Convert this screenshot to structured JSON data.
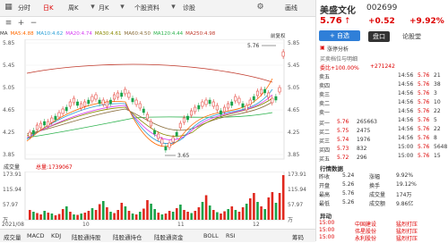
{
  "toolbar": {
    "tabs": [
      "分时",
      "日K",
      "周K",
      "月K",
      "个股资料",
      "诊股"
    ],
    "active_tab": "日K",
    "right_label": "画线"
  },
  "ma_line": {
    "label": "MA",
    "items": [
      {
        "text": "MA5:4.88",
        "color": "#ff6a00"
      },
      {
        "text": "MA10:4.62",
        "color": "#2a9fd6"
      },
      {
        "text": "MA20:4.74",
        "color": "#d63af2"
      },
      {
        "text": "MA30:4.61",
        "color": "#888800"
      },
      {
        "text": "MA60:4.50",
        "color": "#8a6d3b"
      },
      {
        "text": "MA120:4.44",
        "color": "#2bb24c"
      },
      {
        "text": "MA250:4.98",
        "color": "#c0392b"
      }
    ],
    "adjust_label": "前复权"
  },
  "price_chart": {
    "left_ticks": [
      "5.85",
      "5.45",
      "5.05",
      "4.65",
      "4.25",
      "3.85"
    ],
    "right_ticks": [
      "5.85",
      "5.45",
      "5.05",
      "4.65",
      "4.25",
      "3.85"
    ],
    "high_label": "5.76",
    "low_label": "3.65"
  },
  "volume_chart": {
    "title": "成交量",
    "total_label": "总量:1739067",
    "left_ticks": [
      "173.91",
      "115.94",
      "57.97",
      "万"
    ],
    "right_ticks": [
      "173.91",
      "115.94",
      "57.97",
      "万"
    ],
    "x_labels": [
      "2021/08",
      "10",
      "11",
      "12"
    ],
    "bars": [
      {
        "v": 22,
        "up": true
      },
      {
        "v": 18,
        "up": false
      },
      {
        "v": 15,
        "up": true
      },
      {
        "v": 12,
        "up": true
      },
      {
        "v": 20,
        "up": false
      },
      {
        "v": 16,
        "up": true
      },
      {
        "v": 14,
        "up": false
      },
      {
        "v": 10,
        "up": true
      },
      {
        "v": 13,
        "up": true
      },
      {
        "v": 24,
        "up": true
      },
      {
        "v": 30,
        "up": false
      },
      {
        "v": 18,
        "up": true
      },
      {
        "v": 12,
        "up": false
      },
      {
        "v": 11,
        "up": true
      },
      {
        "v": 14,
        "up": false
      },
      {
        "v": 16,
        "up": true
      },
      {
        "v": 20,
        "up": true
      },
      {
        "v": 26,
        "up": false
      },
      {
        "v": 22,
        "up": true
      },
      {
        "v": 35,
        "up": true
      },
      {
        "v": 42,
        "up": false
      },
      {
        "v": 28,
        "up": true
      },
      {
        "v": 18,
        "up": false
      },
      {
        "v": 15,
        "up": true
      },
      {
        "v": 22,
        "up": true
      },
      {
        "v": 38,
        "up": true
      },
      {
        "v": 30,
        "up": false
      },
      {
        "v": 20,
        "up": true
      },
      {
        "v": 14,
        "up": false
      },
      {
        "v": 12,
        "up": true
      },
      {
        "v": 18,
        "up": false
      },
      {
        "v": 25,
        "up": true
      },
      {
        "v": 44,
        "up": true
      },
      {
        "v": 36,
        "up": false
      },
      {
        "v": 24,
        "up": false
      },
      {
        "v": 16,
        "up": true
      },
      {
        "v": 12,
        "up": false
      },
      {
        "v": 14,
        "up": true
      },
      {
        "v": 20,
        "up": true
      },
      {
        "v": 18,
        "up": false
      },
      {
        "v": 26,
        "up": true
      },
      {
        "v": 34,
        "up": false
      },
      {
        "v": 22,
        "up": true
      },
      {
        "v": 18,
        "up": true
      },
      {
        "v": 15,
        "up": false
      },
      {
        "v": 20,
        "up": true
      },
      {
        "v": 28,
        "up": true
      },
      {
        "v": 40,
        "up": false
      },
      {
        "v": 55,
        "up": true
      },
      {
        "v": 32,
        "up": false
      },
      {
        "v": 22,
        "up": true
      },
      {
        "v": 17,
        "up": false
      },
      {
        "v": 14,
        "up": true
      },
      {
        "v": 19,
        "up": true
      },
      {
        "v": 24,
        "up": false
      },
      {
        "v": 30,
        "up": true
      },
      {
        "v": 22,
        "up": false
      },
      {
        "v": 18,
        "up": true
      },
      {
        "v": 28,
        "up": true
      },
      {
        "v": 36,
        "up": false
      },
      {
        "v": 48,
        "up": true
      },
      {
        "v": 60,
        "up": true
      },
      {
        "v": 40,
        "up": false
      },
      {
        "v": 30,
        "up": true
      },
      {
        "v": 24,
        "up": false
      },
      {
        "v": 50,
        "up": true
      },
      {
        "v": 62,
        "up": true
      },
      {
        "v": 38,
        "up": false
      },
      {
        "v": 60,
        "up": true
      },
      {
        "v": 100,
        "up": true
      }
    ]
  },
  "bottom_tabs": [
    "成交量",
    "MACD",
    "KDJ",
    "陆股通持股",
    "陆股通持仓",
    "陆股通资金",
    "BOLL",
    "RSI",
    "筹码"
  ],
  "stock": {
    "name": "美盛文化",
    "code": "002699",
    "price": "5.76",
    "change": "+0.52",
    "pct": "+9.92%",
    "tab_pankou": "盘口",
    "tab_lunpan": "论股堂",
    "hint": "涨停分析",
    "order_title": "买卖档位与明细",
    "order_pct": "委比+100.00%",
    "order_diff": "+271242",
    "add_btn": "+ 自选",
    "asks": [
      {
        "label": "卖五",
        "price": "",
        "vol": ""
      },
      {
        "label": "卖四",
        "price": "",
        "vol": ""
      },
      {
        "label": "卖三",
        "price": "",
        "vol": ""
      },
      {
        "label": "卖二",
        "price": "",
        "vol": ""
      },
      {
        "label": "卖一",
        "price": "",
        "vol": ""
      }
    ],
    "bids": [
      {
        "label": "买一",
        "price": "5.76",
        "vol": "265663"
      },
      {
        "label": "买二",
        "price": "5.75",
        "vol": "2475"
      },
      {
        "label": "买三",
        "price": "5.74",
        "vol": "1976"
      },
      {
        "label": "买四",
        "price": "5.73",
        "vol": "832"
      },
      {
        "label": "买五",
        "price": "5.72",
        "vol": "296"
      }
    ],
    "trades": [
      {
        "time": "14:56",
        "price": "5.76",
        "vol": "21"
      },
      {
        "time": "14:56",
        "price": "5.76",
        "vol": "38"
      },
      {
        "time": "14:56",
        "price": "5.76",
        "vol": "3"
      },
      {
        "time": "14:56",
        "price": "5.76",
        "vol": "10"
      },
      {
        "time": "14:56",
        "price": "5.76",
        "vol": "22"
      },
      {
        "time": "14:56",
        "price": "5.76",
        "vol": "5"
      },
      {
        "time": "14:56",
        "price": "5.76",
        "vol": "22"
      },
      {
        "time": "14:56",
        "price": "5.76",
        "vol": "8"
      },
      {
        "time": "15:00",
        "price": "5.76",
        "vol": "5648"
      },
      {
        "time": "15:00",
        "price": "5.76",
        "vol": "15"
      }
    ],
    "stats_title": "行情数据",
    "stats": [
      {
        "label": "昨收",
        "value": "5.24",
        "label2": "涨幅",
        "value2": "9.92%"
      },
      {
        "label": "开盘",
        "value": "5.26",
        "label2": "换手",
        "value2": "19.12%"
      },
      {
        "label": "最高",
        "value": "5.76",
        "label2": "成交量",
        "value2": "174万"
      },
      {
        "label": "最低",
        "value": "5.26",
        "label2": "成交额",
        "value2": "9.86亿"
      }
    ],
    "news_title": "异动",
    "news": [
      {
        "time": "15:00",
        "tag": "中国建设",
        "name": "猛烈打压"
      },
      {
        "time": "15:00",
        "tag": "伟星股份",
        "name": "猛烈打压"
      },
      {
        "time": "15:00",
        "tag": "永利股份",
        "name": "猛烈打压"
      }
    ]
  }
}
